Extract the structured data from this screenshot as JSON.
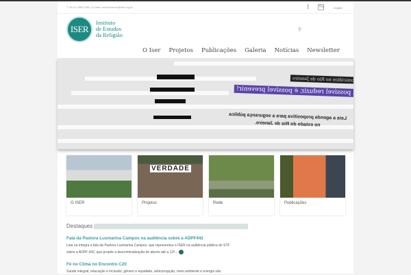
{
  "topbar": {
    "contact": "T. 55 21 2555-3782 | E-mail: comunicacao@iser.org.br",
    "facebook_icon": "f",
    "youtube_icon": "You",
    "language": "english"
  },
  "logo": {
    "mark": "ISER",
    "line1": "Instituto",
    "line2": "de Estudos",
    "line3": "da Religião"
  },
  "search_icon": "🔍",
  "nav": [
    "O Iser",
    "Projetos",
    "Publicações",
    "Galeria",
    "Notícias",
    "Newsletter"
  ],
  "slider": {
    "tag": "Homicídios no Rio de Janeiro",
    "headline": "É possível reduzir, é possível prevenir!",
    "line1": "Leia a agenda propositiva para a segurança pública",
    "line2": "no estado do Rio de Janeiro."
  },
  "cards": [
    {
      "label": "O ISER"
    },
    {
      "label": "Projetos",
      "sign": "VERDADE"
    },
    {
      "label": "Rede"
    },
    {
      "label": "Publicações"
    }
  ],
  "destaques": {
    "heading": "Destaques",
    "items": [
      {
        "title": "Fala da Pastora Lusmarina Campos na audiência sobre a ADPF442",
        "text": "Leia na íntegra a fala da Pastora Lusmarina Campos, que representou o ISER na audiência pública do STF sobre a ADPF 442, que propõe a descriminalização do aborto até a 12ª..."
      },
      {
        "title": "Fé no Clima no Encontro C20",
        "text": "Saúde integral, educação e inclusão, gênero e equidade, anticorrupção, meio ambiente e energia são"
      }
    ]
  }
}
